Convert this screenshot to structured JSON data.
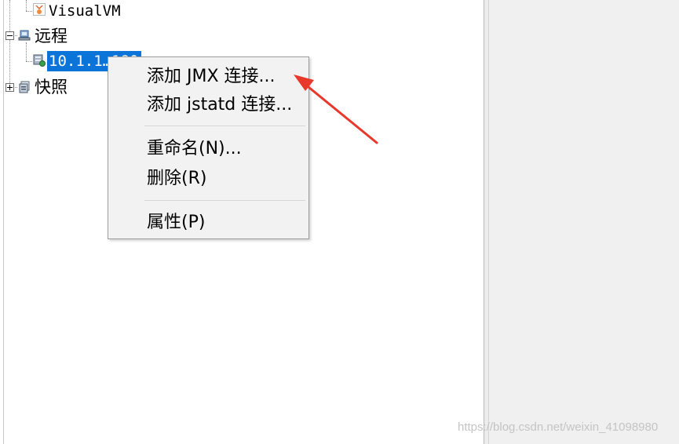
{
  "tree": {
    "nodes": [
      {
        "label": "VisualVM",
        "icon": "visualvm-icon"
      },
      {
        "label": "远程",
        "icon": "remote-hosts-icon",
        "expander": "minus"
      },
      {
        "label": "10.1.1…180",
        "icon": "remote-host-icon",
        "selected": true
      },
      {
        "label": "快照",
        "icon": "snapshots-icon",
        "expander": "plus"
      }
    ]
  },
  "context_menu": {
    "items": [
      {
        "label": "添加 JMX 连接..."
      },
      {
        "label": "添加 jstatd 连接..."
      },
      {
        "label": "重命名(N)..."
      },
      {
        "label": "删除(R)"
      },
      {
        "label": "属性(P)"
      }
    ]
  },
  "annotation": {
    "arrow_color": "#e8382b"
  },
  "colors": {
    "selection": "#0a74d8",
    "menu_background": "#f2f2f2"
  },
  "watermark": "https://blog.csdn.net/weixin_41098980"
}
